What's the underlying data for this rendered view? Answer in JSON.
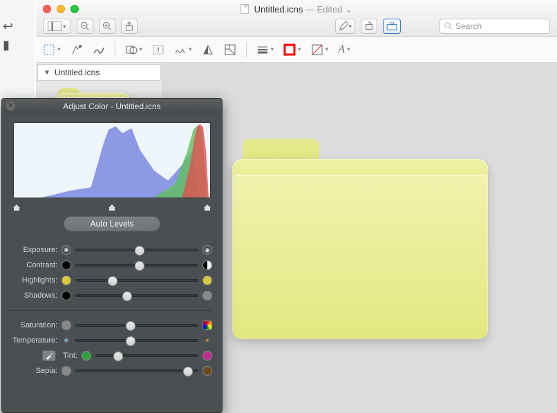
{
  "window": {
    "doc_title": "Untitled.icns",
    "edited_label": "— Edited",
    "dropdown_caret": "⌄"
  },
  "toolbar1": {
    "view_mode": "sidebar-view",
    "zoom_out": "−",
    "zoom_in": "+",
    "share": "⇧",
    "markup": "✎",
    "rotate": "⟳",
    "toolbox": "🧰",
    "search_placeholder": "Search"
  },
  "toolbar2": {
    "select": "▭",
    "lasso": "✦",
    "draw": "〰",
    "shapes": "◻",
    "text": "T",
    "sign": "✒",
    "adjust": "▲",
    "crop": "⛶",
    "line_style": "≡",
    "stroke_color": "#ff0000",
    "fill_pattern": "▨",
    "font": "A"
  },
  "sidebar": {
    "item_label": "Untitled.icns"
  },
  "panel": {
    "title": "Adjust Color - Untitled.icns",
    "auto_levels": "Auto Levels",
    "sliders": {
      "exposure": {
        "label": "Exposure:",
        "value": 52
      },
      "contrast": {
        "label": "Contrast:",
        "value": 52
      },
      "highlights": {
        "label": "Highlights:",
        "value": 30
      },
      "shadows": {
        "label": "Shadows:",
        "value": 42
      },
      "saturation": {
        "label": "Saturation:",
        "value": 45
      },
      "temperature": {
        "label": "Temperature:",
        "value": 45
      },
      "tint": {
        "label": "Tint:",
        "value": 22
      },
      "sepia": {
        "label": "Sepia:",
        "value": 92
      }
    }
  },
  "colors": {
    "folder_base": "#e3e781",
    "panel_bg": "#4a4f52"
  }
}
